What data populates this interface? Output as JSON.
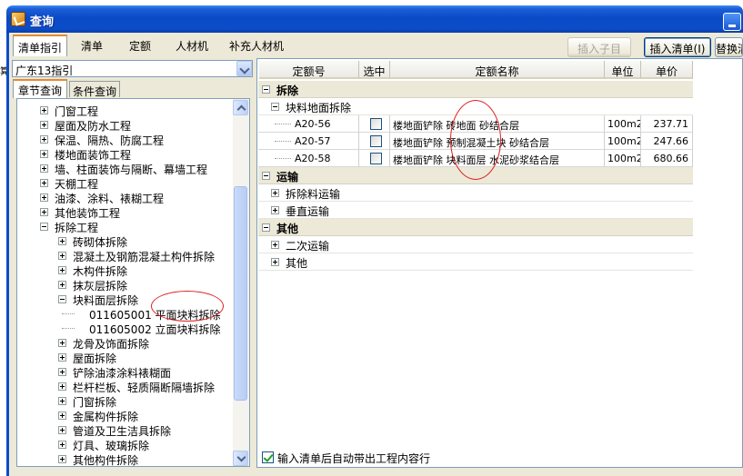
{
  "window": {
    "title": "查询"
  },
  "top_tabs": [
    "清单指引",
    "清单",
    "定额",
    "人材机",
    "补充人材机"
  ],
  "toolbar": {
    "insert_child": "插入子目",
    "insert_list": "插入清单(I)",
    "replace": "替换清"
  },
  "left_edge_fragment": "算",
  "left": {
    "combo_value": "广东13指引",
    "tabs": [
      "章节查询",
      "条件查询"
    ],
    "tree": [
      {
        "label": "门窗工程",
        "level": 1,
        "state": "plus"
      },
      {
        "label": "屋面及防水工程",
        "level": 1,
        "state": "plus"
      },
      {
        "label": "保温、隔热、防腐工程",
        "level": 1,
        "state": "plus"
      },
      {
        "label": "楼地面装饰工程",
        "level": 1,
        "state": "plus"
      },
      {
        "label": "墙、柱面装饰与隔断、幕墙工程",
        "level": 1,
        "state": "plus"
      },
      {
        "label": "天棚工程",
        "level": 1,
        "state": "plus"
      },
      {
        "label": "油漆、涂料、裱糊工程",
        "level": 1,
        "state": "plus"
      },
      {
        "label": "其他装饰工程",
        "level": 1,
        "state": "plus"
      },
      {
        "label": "拆除工程",
        "level": 1,
        "state": "minus"
      },
      {
        "label": "砖砌体拆除",
        "level": 2,
        "state": "plus"
      },
      {
        "label": "混凝土及钢筋混凝土构件拆除",
        "level": 2,
        "state": "plus"
      },
      {
        "label": "木构件拆除",
        "level": 2,
        "state": "plus"
      },
      {
        "label": "抹灰层拆除",
        "level": 2,
        "state": "plus"
      },
      {
        "label": "块料面层拆除",
        "level": 2,
        "state": "minus"
      },
      {
        "label": "011605001  平面块料拆除",
        "level": 3,
        "state": "leaf"
      },
      {
        "label": "011605002  立面块料拆除",
        "level": 3,
        "state": "leaf"
      },
      {
        "label": "龙骨及饰面拆除",
        "level": 2,
        "state": "plus"
      },
      {
        "label": "屋面拆除",
        "level": 2,
        "state": "plus"
      },
      {
        "label": "铲除油漆涂料裱糊面",
        "level": 2,
        "state": "plus"
      },
      {
        "label": "栏杆栏板、轻质隔断隔墙拆除",
        "level": 2,
        "state": "plus"
      },
      {
        "label": "门窗拆除",
        "level": 2,
        "state": "plus"
      },
      {
        "label": "金属构件拆除",
        "level": 2,
        "state": "plus"
      },
      {
        "label": "管道及卫生洁具拆除",
        "level": 2,
        "state": "plus"
      },
      {
        "label": "灯具、玻璃拆除",
        "level": 2,
        "state": "plus"
      },
      {
        "label": "其他构件拆除",
        "level": 2,
        "state": "plus"
      }
    ]
  },
  "grid": {
    "columns": [
      "定额号",
      "选中",
      "定额名称",
      "单位",
      "单价"
    ],
    "groups": [
      {
        "label": "拆除",
        "subs": [
          {
            "label": "块料地面拆除",
            "state": "minus",
            "rows": [
              {
                "code": "A20-56",
                "name": "楼地面铲除 砖地面 砂结合层",
                "unit": "100m2",
                "price": "237.71"
              },
              {
                "code": "A20-57",
                "name": "楼地面铲除 预制混凝土块 砂结合层",
                "unit": "100m2",
                "price": "247.66"
              },
              {
                "code": "A20-58",
                "name": "楼地面铲除 块料面层 水泥砂浆结合层",
                "unit": "100m2",
                "price": "680.66"
              }
            ]
          }
        ]
      },
      {
        "label": "运输",
        "subs": [
          {
            "label": "拆除料运输",
            "state": "plus",
            "rows": []
          },
          {
            "label": "垂直运输",
            "state": "plus",
            "rows": []
          }
        ]
      },
      {
        "label": "其他",
        "subs": [
          {
            "label": "二次运输",
            "state": "plus",
            "rows": []
          },
          {
            "label": "其他",
            "state": "plus",
            "rows": []
          }
        ]
      }
    ]
  },
  "footer": {
    "auto_content_label": "输入清单后自动带出工程内容行",
    "auto_content_checked": true
  }
}
